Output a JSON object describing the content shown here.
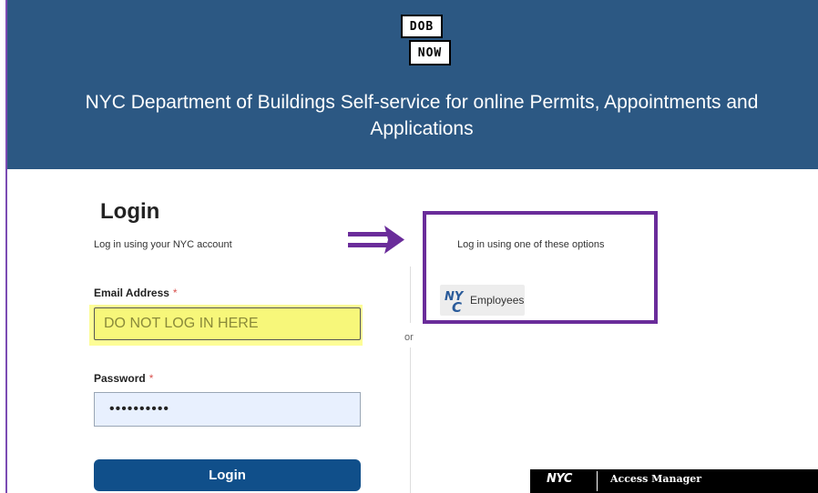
{
  "header": {
    "logo_top": "DOB",
    "logo_bottom": "NOW",
    "title": "NYC Department of Buildings Self-service for online Permits, Appointments and Applications"
  },
  "login": {
    "title": "Login",
    "subtitle": "Log in using your NYC account",
    "email_label": "Email Address",
    "email_required": "*",
    "email_value": "DO NOT LOG IN HERE",
    "password_label": "Password",
    "password_required": "*",
    "password_masked": "••••••••••",
    "button_label": "Login"
  },
  "divider": {
    "text": "or"
  },
  "options": {
    "text": "Log in using one of these options",
    "employees_label": "Employees",
    "employees_icon": "nyc-logo-icon"
  },
  "access_bar": {
    "brand": "NYC",
    "label": "Access Manager"
  },
  "colors": {
    "header_bg": "#2c5883",
    "annotation_purple": "#6a2c9a",
    "login_button": "#104f8a",
    "highlight_yellow": "#fdfd96"
  }
}
